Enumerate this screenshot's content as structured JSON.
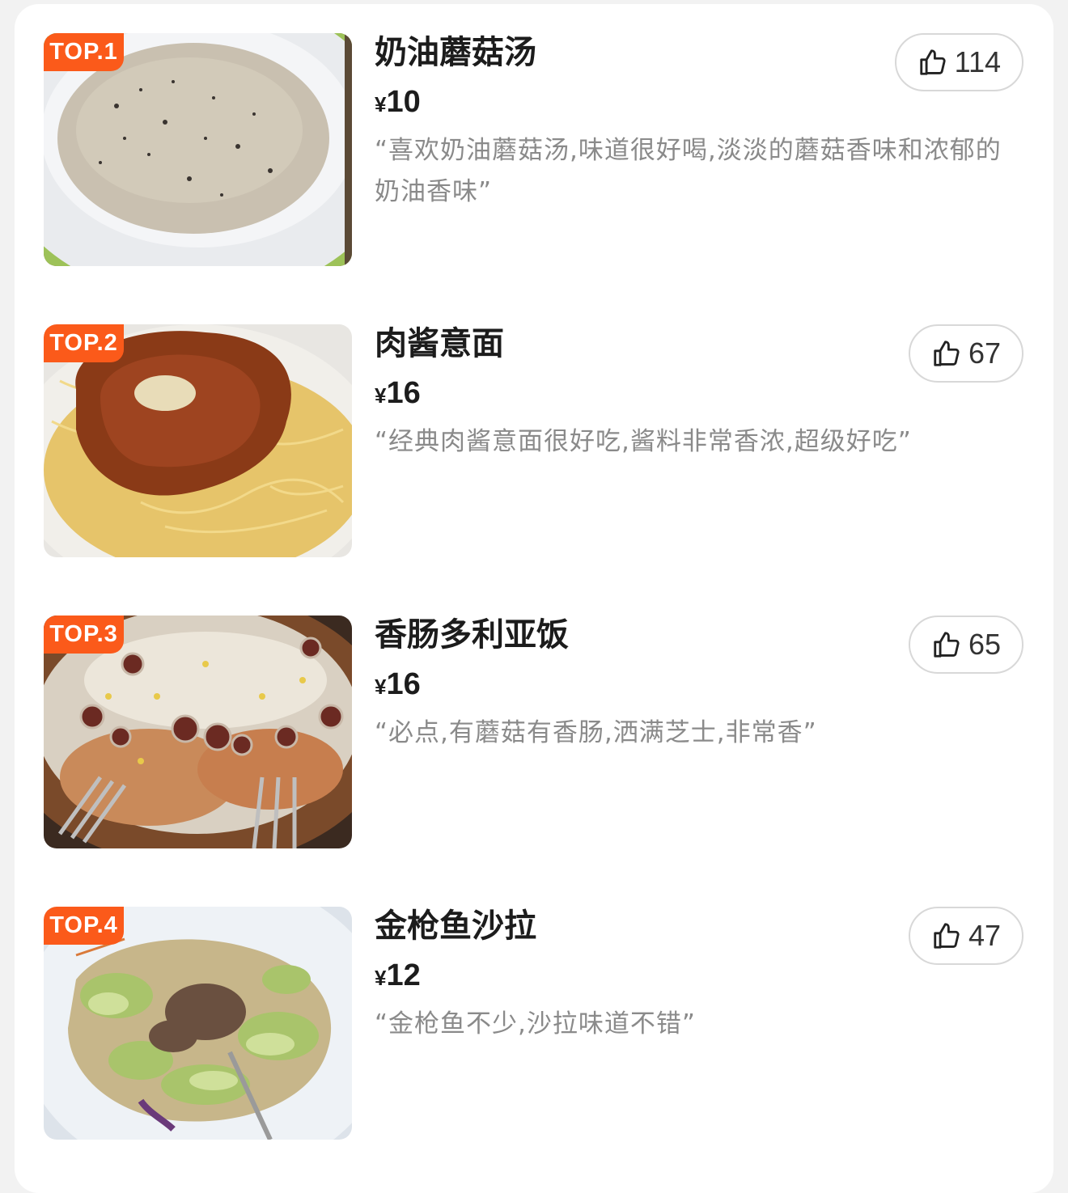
{
  "items": [
    {
      "rank": "TOP.1",
      "name": "奶油蘑菇汤",
      "currency": "¥",
      "price": "10",
      "review": "“喜欢奶油蘑菇汤,味道很好喝,淡淡的蘑菇香味和浓郁的奶油香味”",
      "likes": "114",
      "image": "mushroom-soup"
    },
    {
      "rank": "TOP.2",
      "name": "肉酱意面",
      "currency": "¥",
      "price": "16",
      "review": "“经典肉酱意面很好吃,酱料非常香浓,超级好吃”",
      "likes": "67",
      "image": "bolognese-pasta"
    },
    {
      "rank": "TOP.3",
      "name": "香肠多利亚饭",
      "currency": "¥",
      "price": "16",
      "review": "“必点,有蘑菇有香肠,洒满芝士,非常香”",
      "likes": "65",
      "image": "sausage-doria"
    },
    {
      "rank": "TOP.4",
      "name": "金枪鱼沙拉",
      "currency": "¥",
      "price": "12",
      "review": "“金枪鱼不少,沙拉味道不错”",
      "likes": "47",
      "image": "tuna-salad"
    }
  ],
  "colors": {
    "badge": "#fb5a1a",
    "title": "#1c1c1c",
    "review": "#8a8a8a",
    "like_border": "#d8d8d8"
  },
  "icons": {
    "like": "thumbs-up-icon"
  }
}
